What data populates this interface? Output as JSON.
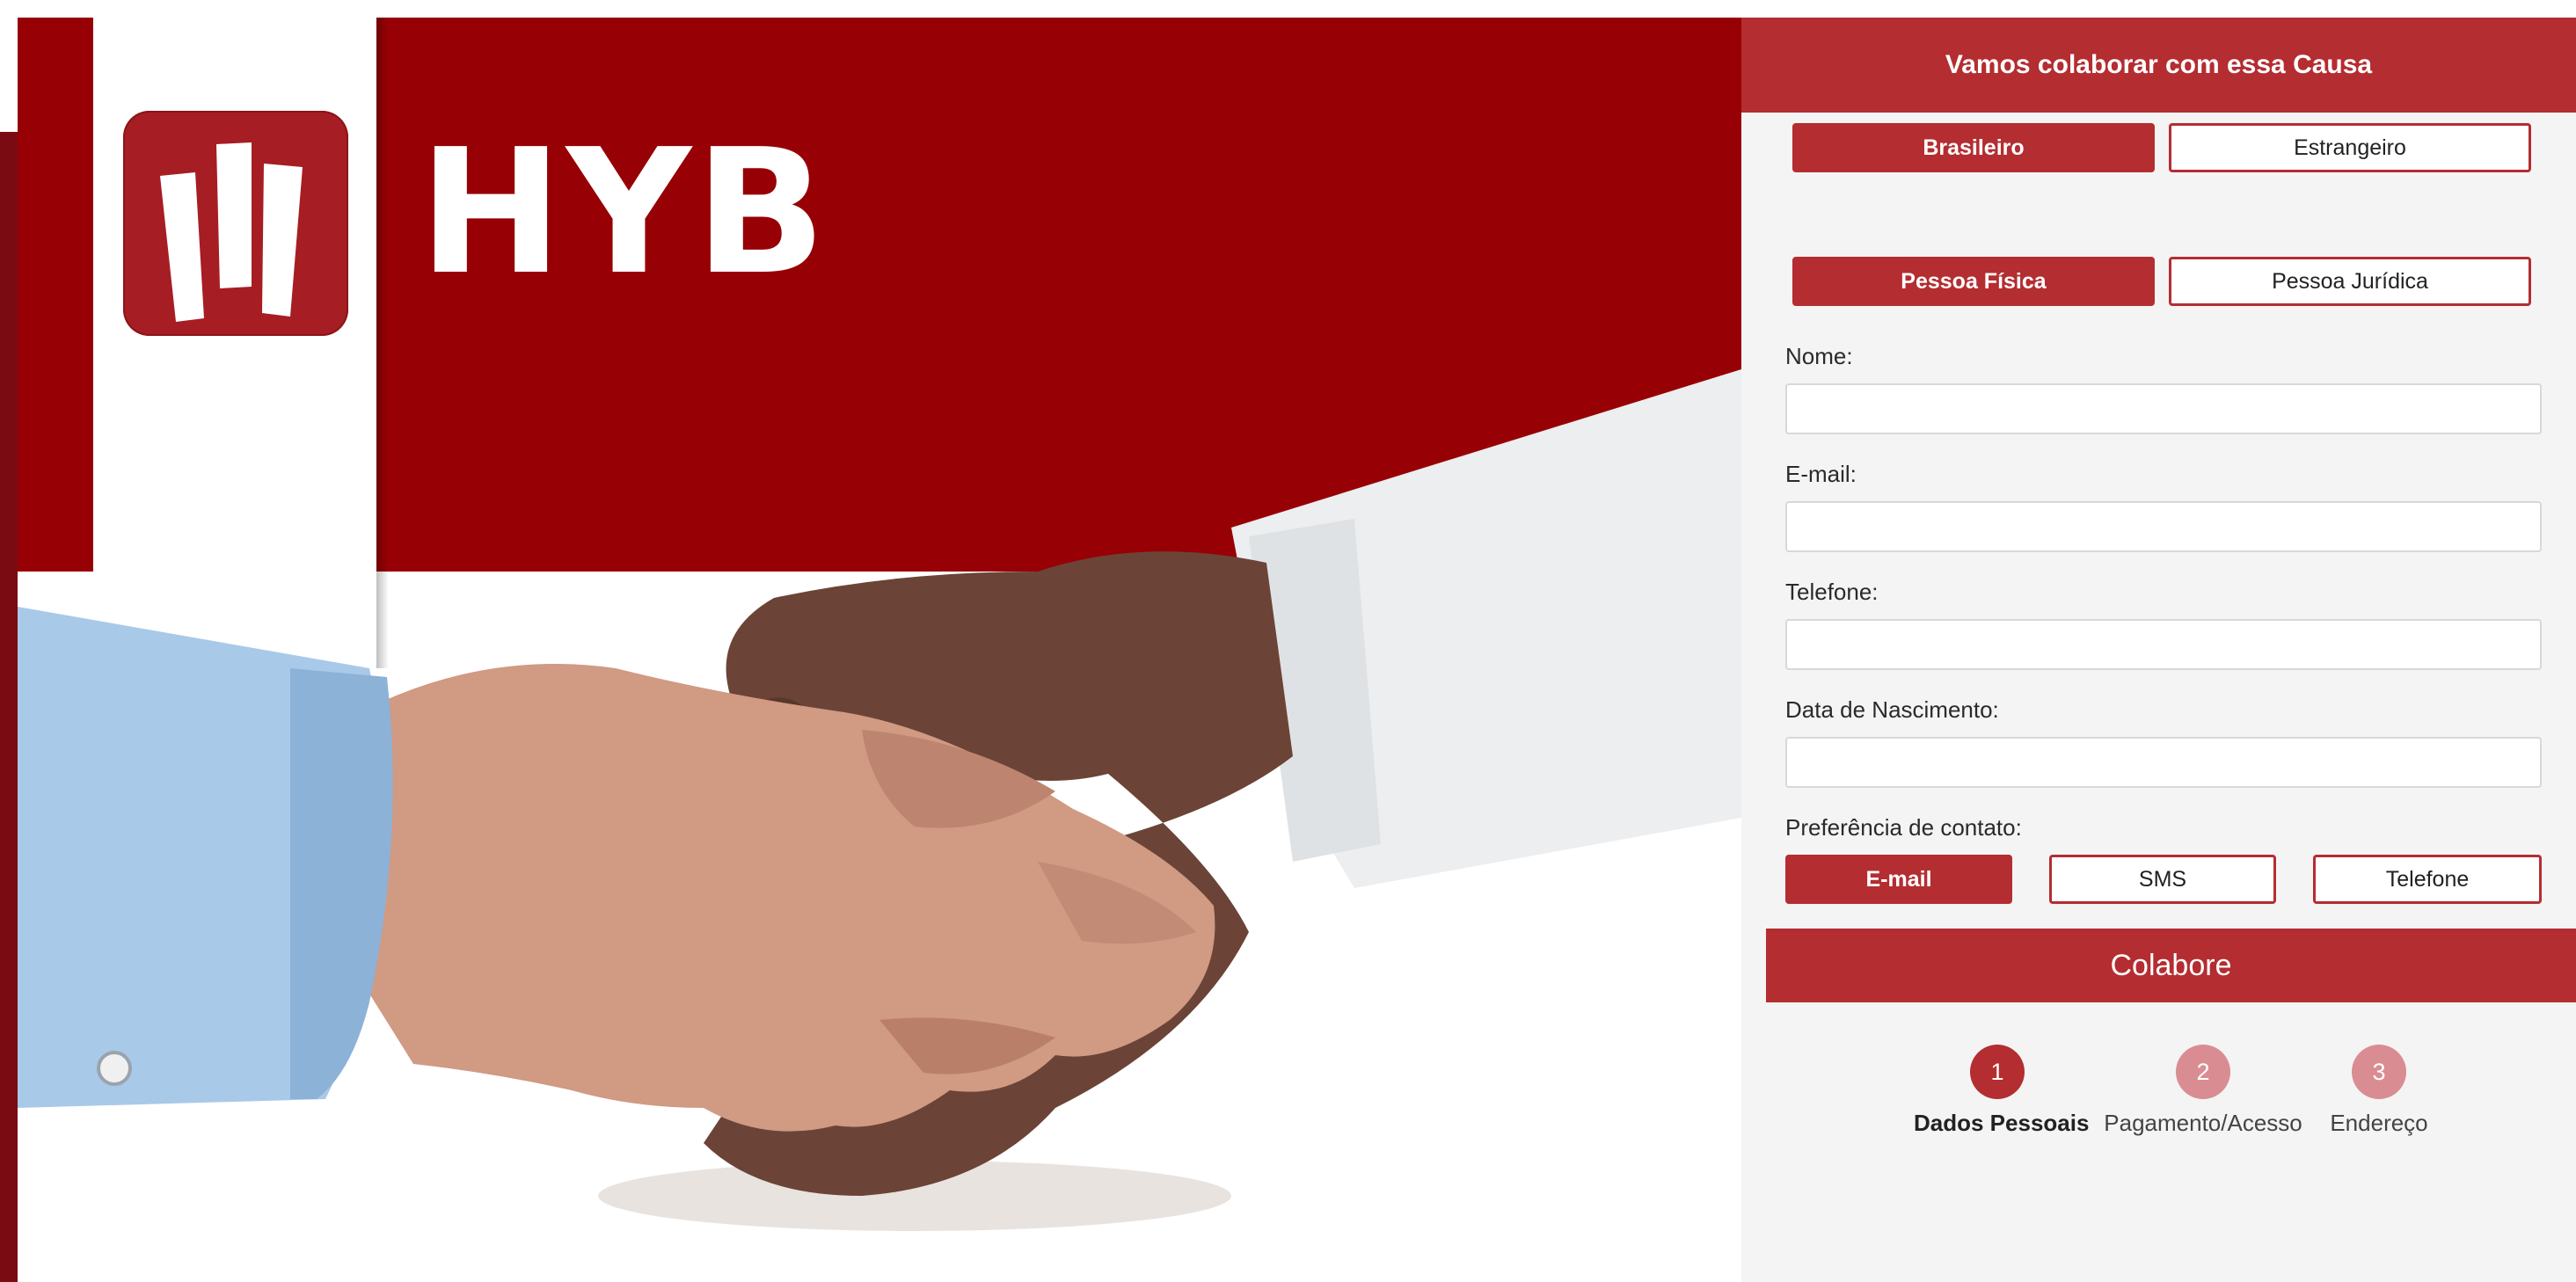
{
  "brand": {
    "name": "HYB",
    "logo_icon": "hyb-logo-icon"
  },
  "hero": {
    "image": "handshake-illustration"
  },
  "form": {
    "title": "Vamos colaborar com essa Causa",
    "nationality": {
      "options": [
        "Brasileiro",
        "Estrangeiro"
      ],
      "selected": "Brasileiro"
    },
    "person_type": {
      "options": [
        "Pessoa Física",
        "Pessoa Jurídica"
      ],
      "selected": "Pessoa Física"
    },
    "fields": {
      "nome": {
        "label": "Nome:",
        "value": ""
      },
      "email": {
        "label": "E-mail:",
        "value": ""
      },
      "telefone": {
        "label": "Telefone:",
        "value": ""
      },
      "nascimento": {
        "label": "Data de Nascimento:",
        "value": ""
      }
    },
    "contact_pref": {
      "label": "Preferência de contato:",
      "options": [
        "E-mail",
        "SMS",
        "Telefone"
      ],
      "selected": "E-mail"
    },
    "submit_label": "Colabore",
    "steps": [
      {
        "number": "1",
        "label": "Dados Pessoais",
        "state": "current"
      },
      {
        "number": "2",
        "label": "Pagamento/Acesso",
        "state": "pending"
      },
      {
        "number": "3",
        "label": "Endereço",
        "state": "pending"
      }
    ]
  },
  "colors": {
    "brand_red": "#b42d31",
    "hero_red": "#970106",
    "step_pending": "#d98d92",
    "panel_bg": "#f4f4f4"
  }
}
